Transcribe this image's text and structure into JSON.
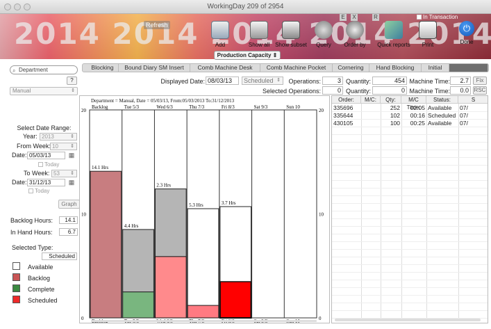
{
  "window": {
    "title": "WorkingDay 209 of 2954"
  },
  "toolbar": {
    "year_text": "2014 2014 2014 2014 2014",
    "refresh_label": "Refresh",
    "e_label": "E",
    "x_label": "X",
    "r_label": "R",
    "in_transaction_label": "In Transaction",
    "buttons": {
      "add": "Add",
      "show_all": "Show all",
      "show_subset": "Show subset",
      "query": "Query",
      "order_by": "Order by",
      "quick_reports": "Quick reports",
      "print": "Print",
      "done": "Done"
    },
    "production_capacity": "Production Capacity"
  },
  "left": {
    "search_placeholder": "Department",
    "help": "?",
    "mode": "Manual",
    "select_date_range": "Select Date Range:",
    "year_label": "Year:",
    "year_value": "2013",
    "from_week_label": "From Week:",
    "from_week_value": "10",
    "date_label": "Date:",
    "from_date": "05/03/13",
    "today_label": "Today",
    "to_week_label": "To Week:",
    "to_week_value": "53",
    "to_date": "31/12/13",
    "graph_label": "Graph",
    "backlog_hours_label": "Backlog Hours:",
    "backlog_hours": "14.1",
    "in_hand_hours_label": "In Hand Hours:",
    "in_hand_hours": "6.7",
    "selected_type_label": "Selected Type:",
    "selected_type": "Scheduled",
    "legend": [
      {
        "label": "Available",
        "color": "#ffffff"
      },
      {
        "label": "Backlog",
        "color": "#c95556"
      },
      {
        "label": "Complete",
        "color": "#3b8a42"
      },
      {
        "label": "Scheduled",
        "color": "#ee2a2a"
      }
    ]
  },
  "tabs": [
    "Blocking",
    "Bound Diary SM Insert",
    "Comb Machine Desk",
    "Comb Machine Pocket",
    "Cornering",
    "Hand Blocking",
    "Initial",
    ""
  ],
  "info": {
    "displayed_date_label": "Displayed Date:",
    "displayed_date": "08/03/13",
    "type_value": "Scheduled",
    "operations_label": "Operations:",
    "operations": "3",
    "quantity_label": "Quantity:",
    "quantity": "454",
    "machine_time_label": "Machine Time:",
    "machine_time": "2.7",
    "fix_label": "Fix",
    "selected_operations_label": "Selected Operations:",
    "selected_operations": "0",
    "sel_quantity": "0",
    "sel_machine_time": "0.0",
    "rsc_label": "RSC"
  },
  "chart_data": {
    "type": "bar",
    "title": "Department = Manual, Date = 05/03/13, From:05/03/2013 To:31/12/2013",
    "categories": [
      "Backlog",
      "Tue 5/3",
      "Wed 6/3",
      "Thu 7/3",
      "Fri 8/3",
      "Sat 9/3",
      "Sun 10"
    ],
    "ylim": [
      0,
      20
    ],
    "yticks": [
      "20",
      "10",
      "0"
    ],
    "bar_labels": [
      "14.1 Hrs",
      "4.4 Hrs",
      "2.3 Hrs",
      "5.3 Hrs",
      "3.7 Hrs",
      "",
      ""
    ],
    "series": [
      {
        "name": "Backlog",
        "color": "#c87d80",
        "values": [
          14.1,
          0,
          0,
          0,
          0,
          0,
          0
        ]
      },
      {
        "name": "Complete",
        "color": "#79b67f",
        "values": [
          0,
          2.5,
          0,
          0,
          0,
          0,
          0
        ]
      },
      {
        "name": "Scheduled",
        "color": "#ff2a2a",
        "values": [
          0,
          0,
          5.9,
          1.2,
          3.5,
          0,
          0
        ]
      },
      {
        "name": "Capacity",
        "color": "#b5b5b5",
        "values": [
          0,
          6.0,
          6.5,
          9.3,
          7.2,
          0,
          0
        ]
      }
    ]
  },
  "orders": {
    "columns": [
      "Order:",
      "M/C:",
      "Qty:",
      "M/C Time:",
      "Status:",
      "S"
    ],
    "rows": [
      [
        "335696",
        "",
        "252",
        "02:05",
        "Available",
        "07/"
      ],
      [
        "335644",
        "",
        "102",
        "00:16",
        "Scheduled",
        "07/"
      ],
      [
        "430105",
        "",
        "100",
        "00:25",
        "Available",
        "07/"
      ]
    ]
  }
}
